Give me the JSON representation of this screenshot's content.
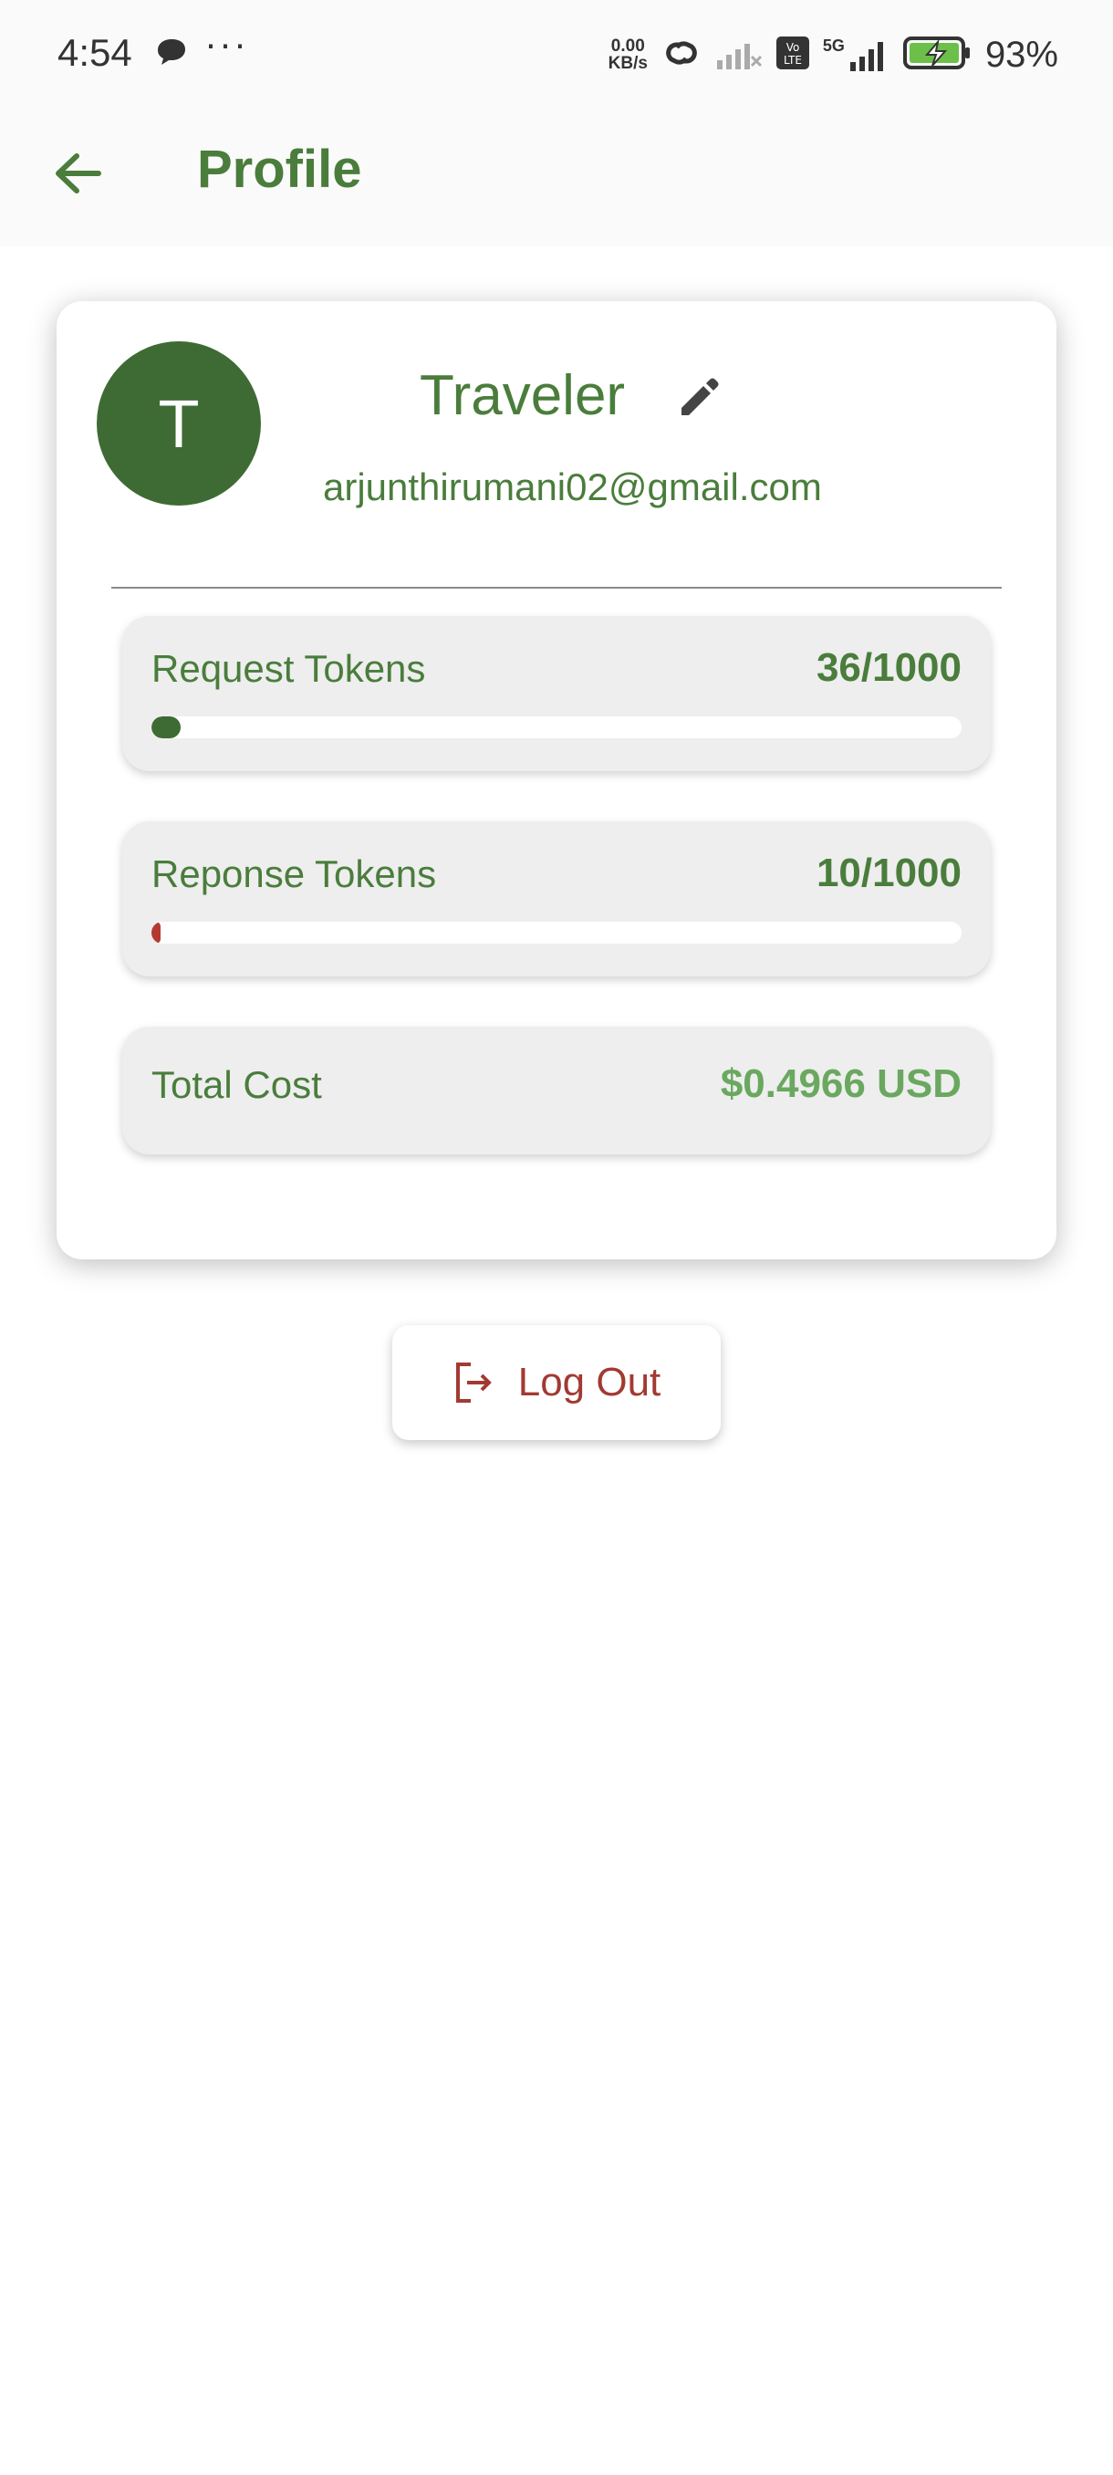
{
  "status_bar": {
    "time": "4:54",
    "dots": "···",
    "speed_top": "0.00",
    "speed_bottom": "KB/s",
    "network": "5G",
    "battery_pct": "93%"
  },
  "app_bar": {
    "title": "Profile"
  },
  "profile": {
    "avatar_initial": "T",
    "name": "Traveler",
    "email": "arjunthirumani02@gmail.com"
  },
  "stats": {
    "request": {
      "label": "Request Tokens",
      "value": "36/1000",
      "used_fraction": 0.036,
      "color": "#3e6b33"
    },
    "response": {
      "label": "Reponse Tokens",
      "value": "10/1000",
      "used_fraction": 0.01,
      "color": "#b33a30"
    },
    "cost": {
      "label": "Total Cost",
      "value": "$0.4966 USD",
      "value_color": "#6aa860"
    }
  },
  "logout": {
    "label": "Log Out"
  },
  "colors": {
    "primary": "#4a7d3c",
    "avatar": "#3e6b33",
    "danger": "#a23a32"
  }
}
